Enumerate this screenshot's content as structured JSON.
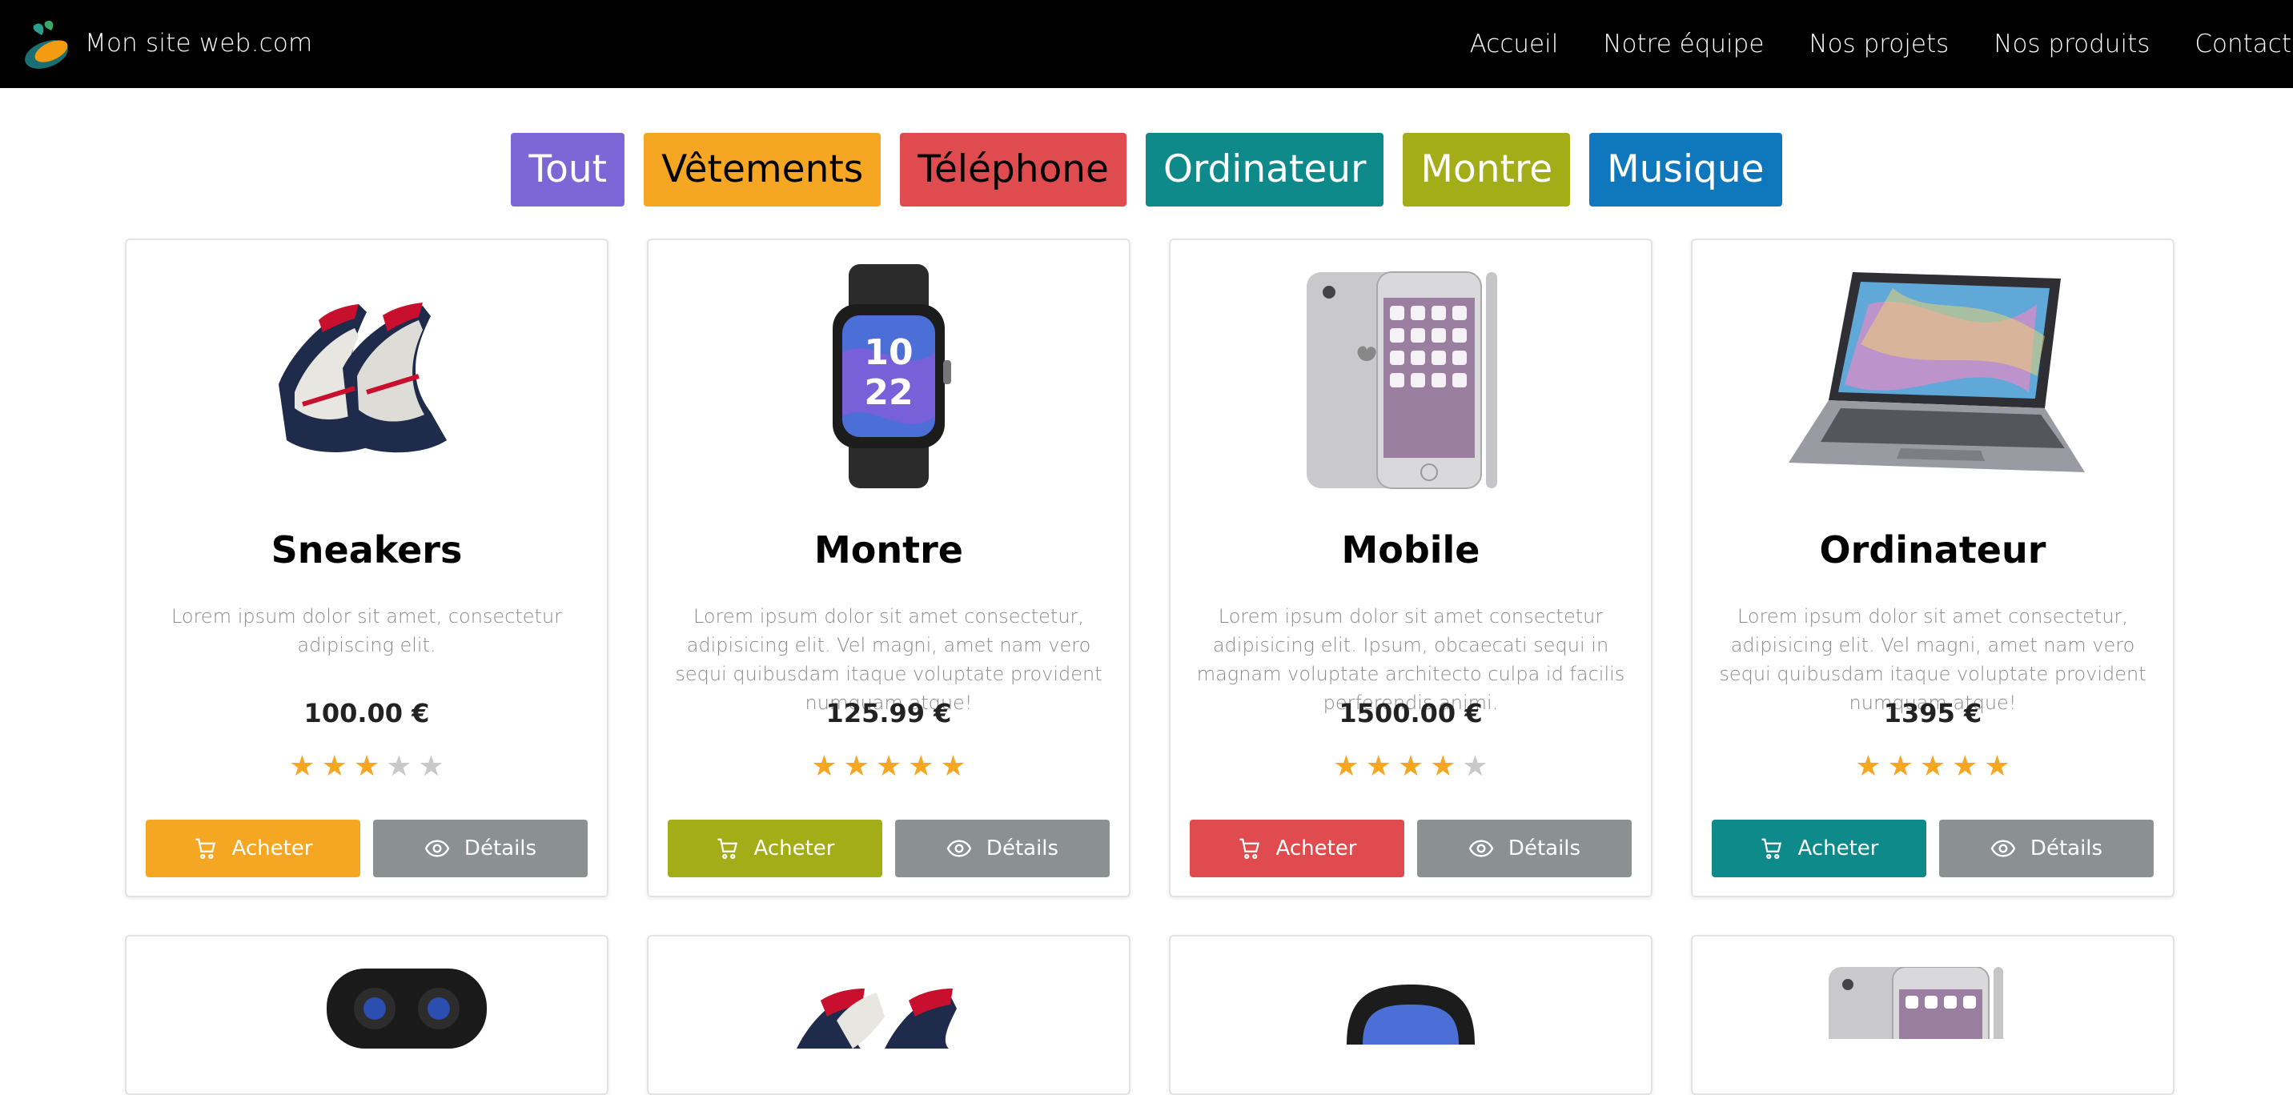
{
  "brand": {
    "name": "Mon site web.com"
  },
  "nav": [
    "Accueil",
    "Notre équipe",
    "Nos projets",
    "Nos produits",
    "Contact"
  ],
  "filters": [
    {
      "label": "Tout",
      "bg": "#7b68d6",
      "fg": "#ffffff"
    },
    {
      "label": "Vêtements",
      "bg": "#f5a623",
      "fg": "#000000"
    },
    {
      "label": "Téléphone",
      "bg": "#e04b4f",
      "fg": "#000000"
    },
    {
      "label": "Ordinateur",
      "bg": "#0f8a8a",
      "fg": "#ffffff"
    },
    {
      "label": "Montre",
      "bg": "#a3ad17",
      "fg": "#ffffff"
    },
    {
      "label": "Musique",
      "bg": "#0f78bd",
      "fg": "#ffffff"
    }
  ],
  "products": [
    {
      "title": "Sneakers",
      "description": "Lorem ipsum dolor sit amet, consectetur adipiscing elit.",
      "price": "100.00 €",
      "rating": 3,
      "image_icon": "sneakers-image",
      "buy_label": "Acheter",
      "details_label": "Détails",
      "accent": "#f5a623"
    },
    {
      "title": "Montre",
      "description": "Lorem ipsum dolor sit amet consectetur, adipisicing elit. Vel magni, amet nam vero sequi quibusdam itaque voluptate provident numquam atque!",
      "price": "125.99 €",
      "rating": 5,
      "image_icon": "smartwatch-image",
      "buy_label": "Acheter",
      "details_label": "Détails",
      "accent": "#a3ad17"
    },
    {
      "title": "Mobile",
      "description": "Lorem ipsum dolor sit amet consectetur adipisicing elit. Ipsum, obcaecati sequi in magnam voluptate architecto culpa id facilis perferendis animi.",
      "price": "1500.00 €",
      "rating": 4,
      "image_icon": "smartphone-image",
      "buy_label": "Acheter",
      "details_label": "Détails",
      "accent": "#e04b4f"
    },
    {
      "title": "Ordinateur",
      "description": "Lorem ipsum dolor sit amet consectetur, adipisicing elit. Vel magni, amet nam vero sequi quibusdam itaque voluptate provident numquam atque!",
      "price": "1395 €",
      "rating": 5,
      "image_icon": "laptop-image",
      "buy_label": "Acheter",
      "details_label": "Détails",
      "accent": "#0f8a8a"
    }
  ],
  "products_row2": [
    {
      "image_icon": "earbuds-image"
    },
    {
      "image_icon": "sneakers-image"
    },
    {
      "image_icon": "smartwatch-image"
    },
    {
      "image_icon": "smartphone-image"
    }
  ]
}
